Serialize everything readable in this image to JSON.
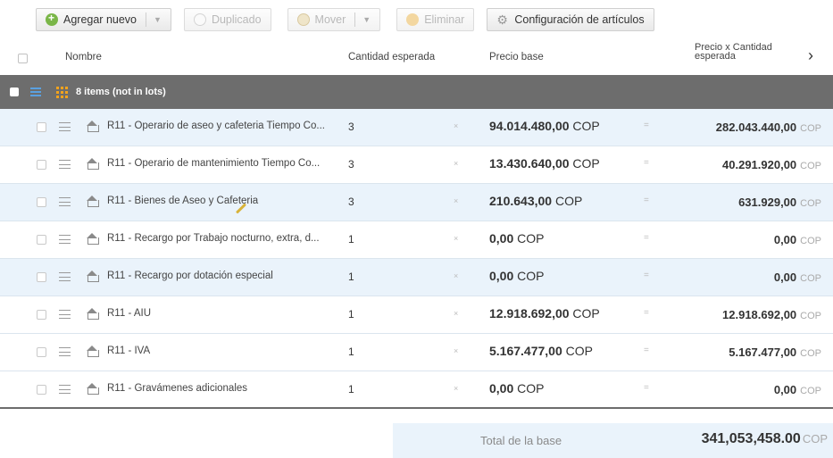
{
  "toolbar": {
    "add_label": "Agregar nuevo",
    "duplicate_label": "Duplicado",
    "move_label": "Mover",
    "delete_label": "Eliminar",
    "config_label": "Configuración de artículos"
  },
  "table": {
    "headers": {
      "name": "Nombre",
      "expected_qty": "Cantidad esperada",
      "base_price": "Precio base",
      "price_x_qty_line1": "Precio x Cantidad",
      "price_x_qty_line2": "esperada"
    },
    "group_title": "8 items (not in lots)",
    "rows": [
      {
        "name": "R11 - Operario de aseo y cafeteria Tiempo Co...",
        "qty": "3",
        "price": "94.014.480,00",
        "price_cur": "COP",
        "total": "282.043.440,00",
        "total_cur": "COP"
      },
      {
        "name": "R11 - Operario de mantenimiento Tiempo Co...",
        "qty": "3",
        "price": "13.430.640,00",
        "price_cur": "COP",
        "total": "40.291.920,00",
        "total_cur": "COP"
      },
      {
        "name": "R11 - Bienes de Aseo y Cafeteria",
        "qty": "3",
        "price": "210.643,00",
        "price_cur": "COP",
        "total": "631.929,00",
        "total_cur": "COP"
      },
      {
        "name": "R11 - Recargo por Trabajo nocturno, extra, d...",
        "qty": "1",
        "price": "0,00",
        "price_cur": "COP",
        "total": "0,00",
        "total_cur": "COP"
      },
      {
        "name": "R11 - Recargo por dotación especial",
        "qty": "1",
        "price": "0,00",
        "price_cur": "COP",
        "total": "0,00",
        "total_cur": "COP"
      },
      {
        "name": "R11 - AIU",
        "qty": "1",
        "price": "12.918.692,00",
        "price_cur": "COP",
        "total": "12.918.692,00",
        "total_cur": "COP"
      },
      {
        "name": "R11 - IVA",
        "qty": "1",
        "price": "5.167.477,00",
        "price_cur": "COP",
        "total": "5.167.477,00",
        "total_cur": "COP"
      },
      {
        "name": "R11 - Gravámenes adicionales",
        "qty": "1",
        "price": "0,00",
        "price_cur": "COP",
        "total": "0,00",
        "total_cur": "COP"
      }
    ],
    "times_symbol": "×",
    "equals_symbol": "="
  },
  "footer": {
    "label": "Total de la base",
    "total": "341,053,458.00",
    "currency": "COP"
  },
  "colors": {
    "group_bar": "#6d6d6d",
    "row_alt": "#eaf3fb",
    "accent_orange": "#f3a31c",
    "accent_blue": "#5aa0e0"
  }
}
